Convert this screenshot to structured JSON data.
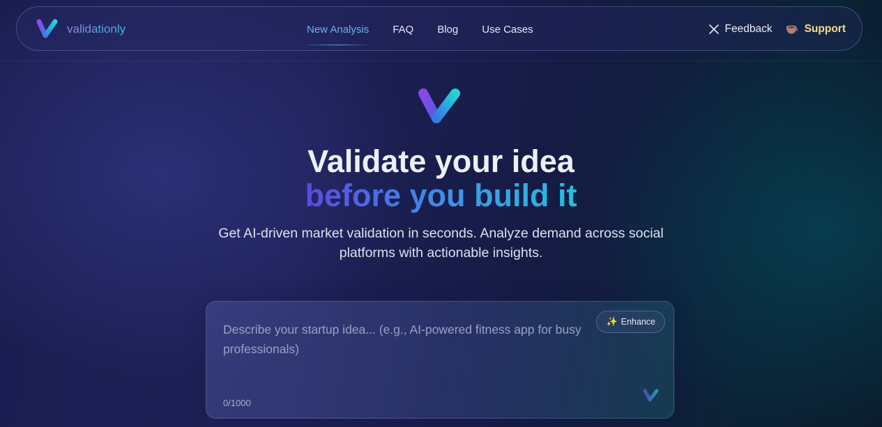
{
  "brand": {
    "name": "validationly",
    "logo_icon": "v-logo-icon"
  },
  "nav": {
    "links": [
      {
        "label": "New Analysis",
        "active": true
      },
      {
        "label": "FAQ",
        "active": false
      },
      {
        "label": "Blog",
        "active": false
      },
      {
        "label": "Use Cases",
        "active": false
      }
    ],
    "feedback_label": "Feedback",
    "feedback_icon": "close-x-icon",
    "support_label": "Support",
    "support_icon": "coffee-cup-icon"
  },
  "hero": {
    "title_line1": "Validate your idea",
    "title_line2": "before you build it",
    "subtitle": "Get AI-driven market validation in seconds. Analyze demand across social platforms with actionable insights."
  },
  "idea_form": {
    "value": "",
    "placeholder": "Describe your startup idea... (e.g., AI-powered fitness app for busy professionals)",
    "enhance_label": "Enhance",
    "enhance_icon": "sparkles-icon",
    "counter": "0/1000",
    "max_length": 1000
  },
  "colors": {
    "background": "#1c1e52",
    "accent_blue": "#6cb3ec",
    "support_gold": "#f6dc86",
    "gradient_start": "#5b4ae0",
    "gradient_end": "#22c0dd"
  }
}
